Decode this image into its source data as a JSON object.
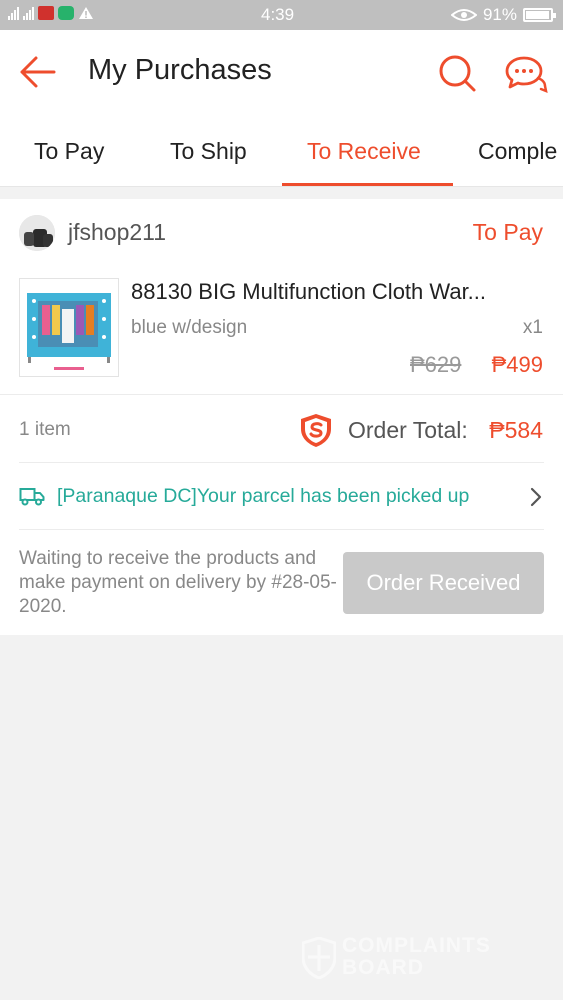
{
  "status_bar": {
    "time": "4:39",
    "battery": "91%",
    "icons": [
      "signal-icon",
      "notification-icon",
      "chat-app-icon",
      "warning-icon",
      "eye-icon",
      "battery-icon"
    ]
  },
  "header": {
    "title": "My Purchases",
    "icons": [
      "back-arrow-icon",
      "search-icon",
      "chat-icon"
    ]
  },
  "tabs": [
    {
      "label": "To Pay"
    },
    {
      "label": "To Ship"
    },
    {
      "label": "To Receive"
    },
    {
      "label": "Comple"
    }
  ],
  "order": {
    "shop_name": "jfshop211",
    "status": "To Pay",
    "product": {
      "name": "88130 BIG Multifunction Cloth War...",
      "variant": "blue w/design",
      "quantity": "x1",
      "original_price": "₱629",
      "price": "₱499"
    },
    "item_count": "1 item",
    "total_label": "Order Total:",
    "total_value": "₱584",
    "tracking": "[Paranaque DC]Your parcel has been picked up",
    "note": "Waiting to receive the products and make payment on delivery by #28-05-2020.",
    "button_label": "Order Received"
  },
  "watermark": {
    "line1": "COMPLAINTS",
    "line2": "BOARD"
  },
  "colors": {
    "accent": "#ee4d2d",
    "tracking": "#26aa99",
    "button_disabled": "#c9c9c9"
  }
}
